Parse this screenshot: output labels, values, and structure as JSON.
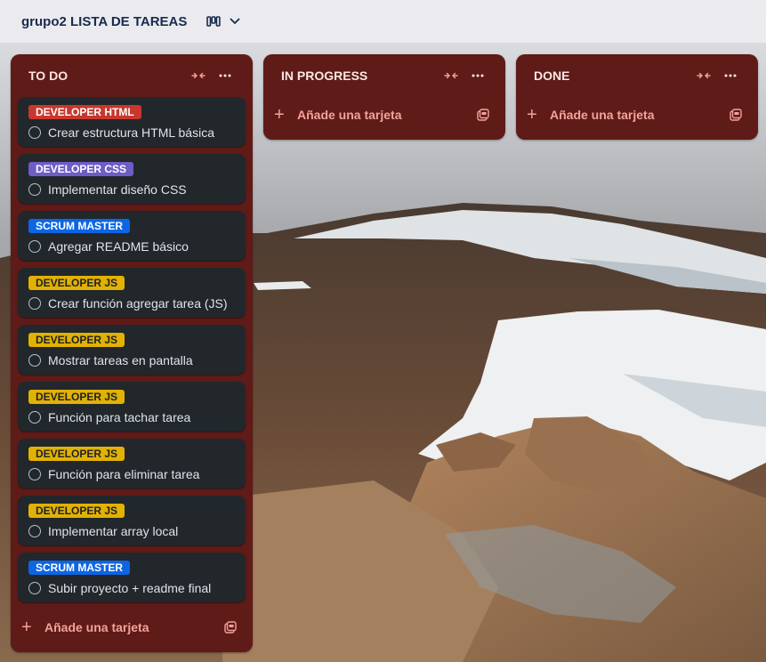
{
  "board": {
    "title": "grupo2 LISTA DE TAREAS"
  },
  "colors": {
    "list_bg": "#5e1b18",
    "card_bg": "#22272b",
    "add_text": "#f4a29b"
  },
  "lists": [
    {
      "title": "TO DO",
      "add_label": "Añade una tarjeta",
      "cards": [
        {
          "label": "DEVELOPER HTML",
          "label_color": "red",
          "text": "Crear estructura HTML básica"
        },
        {
          "label": "DEVELOPER CSS",
          "label_color": "purple",
          "text": "Implementar diseño CSS"
        },
        {
          "label": "SCRUM MASTER",
          "label_color": "blue",
          "text": "Agregar README básico"
        },
        {
          "label": "DEVELOPER JS",
          "label_color": "yellow",
          "text": "Crear función agregar tarea (JS)"
        },
        {
          "label": "DEVELOPER JS",
          "label_color": "yellow",
          "text": "Mostrar tareas en pantalla"
        },
        {
          "label": "DEVELOPER JS",
          "label_color": "yellow",
          "text": "Función para tachar tarea"
        },
        {
          "label": "DEVELOPER JS",
          "label_color": "yellow",
          "text": "Función para eliminar tarea"
        },
        {
          "label": "DEVELOPER JS",
          "label_color": "yellow",
          "text": "Implementar array local"
        },
        {
          "label": "SCRUM MASTER",
          "label_color": "blue",
          "text": "Subir proyecto + readme final"
        }
      ]
    },
    {
      "title": "IN PROGRESS",
      "add_label": "Añade una tarjeta",
      "cards": []
    },
    {
      "title": "DONE",
      "add_label": "Añade una tarjeta",
      "cards": []
    }
  ],
  "icons": {
    "view_switcher": "board-view-icon",
    "collapse": "collapse-icon",
    "menu": "more-options-icon",
    "add": "plus-icon",
    "template": "card-template-icon"
  }
}
